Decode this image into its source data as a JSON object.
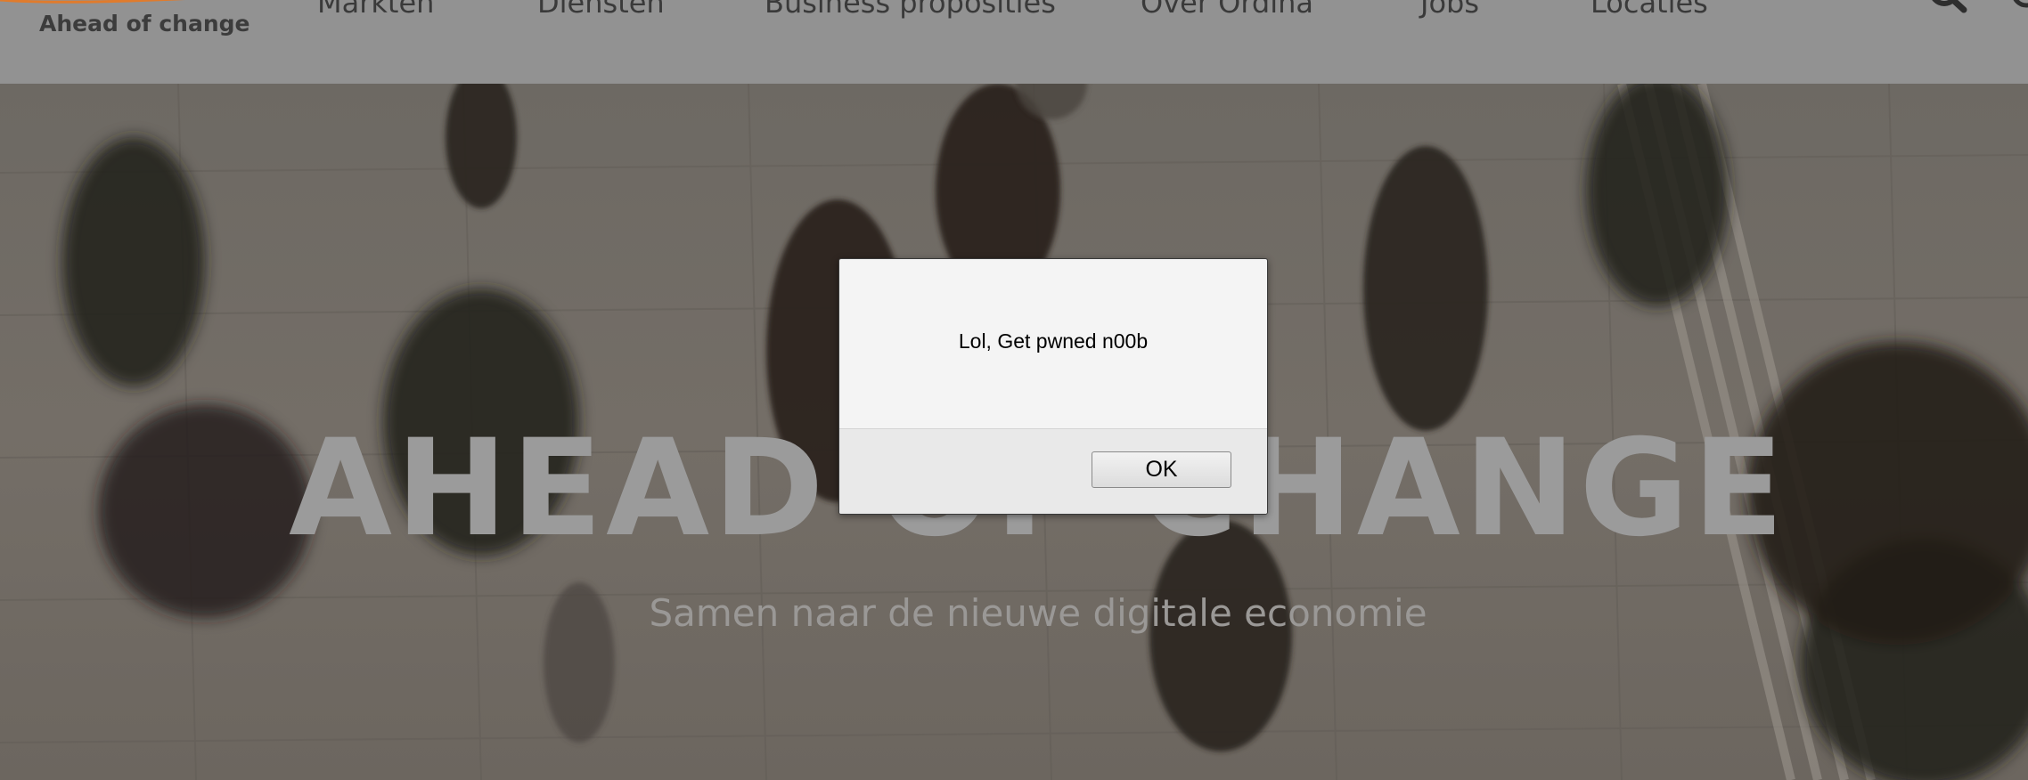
{
  "header": {
    "logo_tagline": "Ahead of change",
    "nav": [
      {
        "label": "Markten"
      },
      {
        "label": "Diensten"
      },
      {
        "label": "Business proposities"
      },
      {
        "label": "Over Ordina"
      },
      {
        "label": "Jobs"
      },
      {
        "label": "Locaties"
      }
    ],
    "search_icon": "search-icon"
  },
  "hero": {
    "title": "AHEAD OF CHANGE",
    "subtitle": "Samen naar de nieuwe digitale economie"
  },
  "alert": {
    "message": "Lol, Get pwned n00b",
    "ok_label": "OK"
  },
  "colors": {
    "header_bg": "#929292",
    "logo_accent": "#e07b2c",
    "hero_overlay": "#6f6a65",
    "dialog_bg": "#f4f4f4"
  }
}
